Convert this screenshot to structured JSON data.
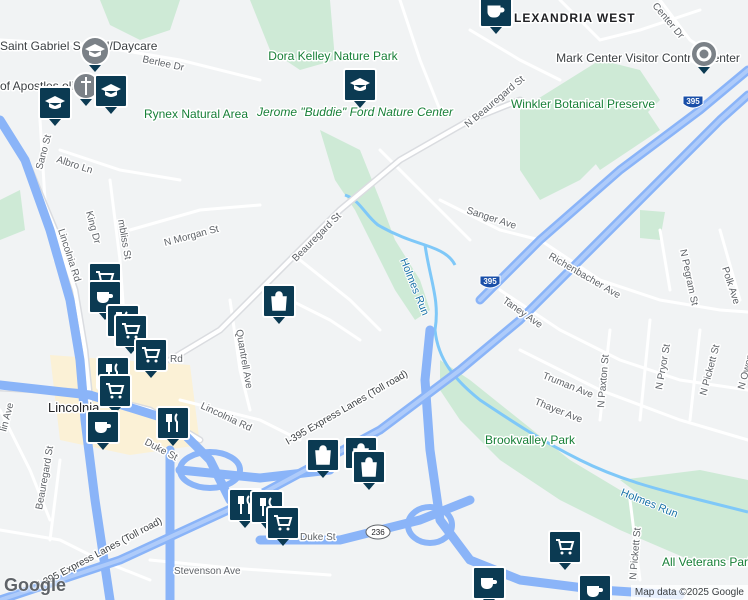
{
  "map": {
    "neighborhood": "ALEXANDRIA WEST",
    "city": "Lincolnia",
    "parks": {
      "rynex": "Rynex Natural Area",
      "dora_kelley": "Dora Kelley Nature Park",
      "jerome_ford": "Jerome \"Buddie\" Ford Nature Center",
      "winkler": "Winkler Botanical Preserve",
      "brookvalley": "Brookvalley Park",
      "all_veterans": "All Veterans Park"
    },
    "pois": {
      "saint_gabriel": "Saint Gabriel School/Daycare",
      "apostles": "of Apostles olic Ch",
      "mark_center": "Mark Center Visitor Control Center"
    },
    "water": {
      "holmes_run_1": "Holmes Run",
      "holmes_run_2": "Holmes Run"
    },
    "streets": {
      "berlee": "Berlee Dr",
      "sano": "Sano St",
      "albro": "Albro Ln",
      "king": "King Dr",
      "chambliss": "mbliss St",
      "n_morgan": "N Morgan St",
      "lincolnia_rd_v": "Lincolnia Rd",
      "beauregard_st": "Beauregard St",
      "n_beauregard": "N Beauregard St",
      "sanger": "Sanger Ave",
      "richenbacher": "Richenbacher Ave",
      "n_pegram": "N Pegram St",
      "polk": "Polk Ave",
      "taney": "Taney Ave",
      "n_paxton": "N Paxton St",
      "n_pryor": "N Pryor St",
      "n_pickett": "N Pickett St",
      "n_owen": "N Owen",
      "truman": "Truman Ave",
      "thayer": "Thayer Ave",
      "quantrell": "Quantrell Ave",
      "lincolnia_rd": "Lincolnia Rd",
      "duke_st_1": "Duke St",
      "duke_st_2": "Duke St",
      "beauregard_sw": "Beauregard St",
      "lin": "lin Ave",
      "stevenson": "Stevenson Ave",
      "n_pickett_2": "N Pickett St",
      "center_dr": "Center Dr",
      "rd": "Rd",
      "i395_express_1": "I-395 Express Lanes (Toll road)",
      "i395_express_2": "I-395 Express Lanes (Toll road)"
    },
    "shields": {
      "i395_a": "395",
      "i395_b": "395",
      "route236": "236"
    },
    "attribution": "Map data ©2025 Google",
    "logo": "Google"
  },
  "pins": [
    {
      "icon": "coffee-icon"
    },
    {
      "icon": "school-icon"
    },
    {
      "icon": "church-icon"
    },
    {
      "icon": "school-icon"
    },
    {
      "icon": "school-icon"
    },
    {
      "icon": "museum-icon"
    },
    {
      "icon": "shopping-cart-icon"
    },
    {
      "icon": "coffee-icon"
    },
    {
      "icon": "restaurant-icon"
    },
    {
      "icon": "shopping-cart-icon"
    },
    {
      "icon": "restaurant-icon"
    },
    {
      "icon": "coffee-icon"
    },
    {
      "icon": "restaurant-icon"
    },
    {
      "icon": "shopping-bag-icon"
    },
    {
      "icon": "shopping-bag-icon"
    },
    {
      "icon": "shopping-bag-icon"
    },
    {
      "icon": "restaurant-icon"
    },
    {
      "icon": "shopping-cart-icon"
    },
    {
      "icon": "shopping-cart-icon"
    },
    {
      "icon": "coffee-icon"
    },
    {
      "icon": "coffee-icon"
    }
  ],
  "colors": {
    "land": "#f1f3f4",
    "park": "#ceead6",
    "highway": "#8ab4f8",
    "water": "#7fc8f8",
    "pin": "#0b3a52"
  }
}
